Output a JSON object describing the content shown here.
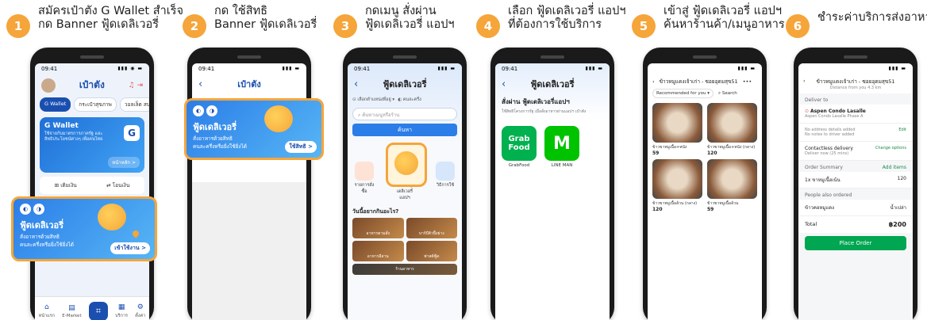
{
  "steps": [
    {
      "num": "1",
      "line1": "สมัครเป๋าตัง G Wallet สำเร็จ",
      "line2": "กด Banner ฟู้ดเดลิเวอรี่"
    },
    {
      "num": "2",
      "line1": "กด ใช้สิทธิ",
      "line2": "Banner ฟู้ดเดลิเวอรี่"
    },
    {
      "num": "3",
      "line1": "กดเมนู สั่งผ่าน",
      "line2": "ฟู้ดเดลิเวอรี่ แอปฯ"
    },
    {
      "num": "4",
      "line1": "เลือก ฟู้ดเดลิเวอรี่ แอปฯ",
      "line2": "ที่ต้องการใช้บริการ"
    },
    {
      "num": "5",
      "line1": "เข้าสู่ ฟู้ดเดลิเวอรี่ แอปฯ",
      "line2": "ค้นหาร้านค้า/เมนูอาหาร"
    },
    {
      "num": "6",
      "line1": "ชำระค่าบริการส่งอาหาร",
      "line2": ""
    }
  ],
  "status_time": "09:41",
  "phone1": {
    "title": "เป๋าตัง",
    "chips": [
      "G Wallet",
      "กระเป๋าสุขภาพ",
      "วอลเล็ต สบม."
    ],
    "gw_title": "G Wallet",
    "gw_desc": "ใช้จ่ายกับมาตรการภาครัฐ และสิทธิประโยชน์ต่างๆ เพื่อคนไทย",
    "gw_logo": "G",
    "gw_link": "หน้าหลัก >",
    "actions": [
      "เติมเงิน",
      "โอนเงิน"
    ],
    "nav": [
      "หน้าแรก",
      "E-Market",
      "",
      "บริการ",
      "ตั้งค่า"
    ]
  },
  "banner": {
    "title": "ฟู้ดเดลิเวอรี่",
    "desc1": "สั่งอาหารด้วยสิทธิ",
    "desc2": "คนละครึ่งหรือยิ่งใช้ยิ่งได้",
    "btn_phone1": "เข้าใช้งาน >",
    "btn_phone2": "ใช้สิทธิ >"
  },
  "phone2": {
    "title": "เป๋าตัง"
  },
  "phone3": {
    "title": "ฟู้ดเดลิเวอรี่",
    "loc": "เลือกตำแหน่งที่อยู่",
    "scheme": "คนละครึ่ง",
    "search_ph": "ค้นหาเมนูหรือร้าน",
    "find": "ค้นหา",
    "menus": [
      "รายการสั่งซื้อ",
      "สั่งผ่าน ฟู้ดเดลิเวอรี่ แอปฯ",
      "วิธีการใช้"
    ],
    "food_head": "วันนี้อยากกินอะไร?",
    "foods": [
      "อาหารตามสั่ง",
      "บาร์บีคิวปิ้งย่าง",
      "อาหารอีสาน",
      "ฟาสต์ฟู้ด"
    ],
    "food_more": "ร้านอาหาร"
  },
  "phone4": {
    "title": "ฟู้ดเดลิเวอรี่",
    "sub": "สั่งผ่าน ฟู้ดเดลิเวอรี่แอปฯ",
    "desc": "ใช้สิทธิโครงการรัฐ เมื่อสั่งอาหารผ่านแอปฯ เป๋าตัง",
    "apps": [
      {
        "logo": "Grab Food",
        "name": "GrabFood"
      },
      {
        "logo": "M",
        "name": "LINE MAN"
      }
    ]
  },
  "phone5": {
    "shop": "ข้าวหมูแดงเจ้าเก่า - ซอยอุดมสุข51",
    "filter": "Recommended for you",
    "search": "Search",
    "dishes": [
      {
        "name": "ข้าวขาหมูเนื้อ+หนัง",
        "price": "59"
      },
      {
        "name": "ข้าวขาหมูเนื้อ+หนัง (กลาง)",
        "price": "120"
      },
      {
        "name": "ข้าวขาหมูเนื้อล้วน (กลาง)",
        "price": "120"
      },
      {
        "name": "ข้าวขาหมูเนื้อล้วน",
        "price": "59"
      }
    ]
  },
  "phone6": {
    "shop": "ข้าวหมูแดงเจ้าเก่า - ซอยอุดมสุข51",
    "distance": "Distance from you 4.3 km",
    "deliver_to": "Deliver to",
    "addr_name": "Aspen Condo Lasalle",
    "addr_detail": "Aspen Condo Lasalle Phase A",
    "no_addr": "No address details added",
    "no_note": "No notes to driver added",
    "edit": "Edit",
    "contactless": "Contactless delivery",
    "deliver_now": "Deliver now (25 mins)",
    "change": "Change options",
    "order_summary": "Order Summary",
    "add_items": "Add items",
    "qty": "1x",
    "item": "ขาหมูเนื้อเน้น",
    "item_price": "120",
    "also_ordered": "People also ordered",
    "also_1": "ข้าวคอหมูแดง",
    "also_2": "น้ำเปล่า",
    "total_label": "Total",
    "total": "฿200",
    "place": "Place Order"
  },
  "colors": {
    "accent": "#f5a53a",
    "brand": "#1a4fb0",
    "grab": "#00b14f",
    "lineman": "#00c300",
    "place": "#00a651"
  }
}
